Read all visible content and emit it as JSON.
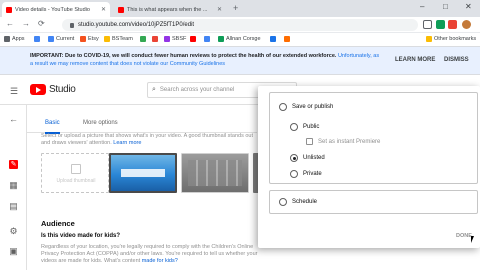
{
  "browser": {
    "tabs": [
      {
        "label": "Video details - YouTube Studio",
        "active": true
      },
      {
        "label": "This is what appears when the ...",
        "active": false
      }
    ],
    "new_tab": "+",
    "window_controls": {
      "minimize": "–",
      "maximize": "□",
      "close": "✕"
    },
    "back": "←",
    "forward": "→",
    "reload": "⟳",
    "url": "studio.youtube.com/video/10jPZ5fT1P0/edit"
  },
  "bookmarks": {
    "items": [
      {
        "label": "Apps",
        "color": "#5f6368"
      },
      {
        "label": "",
        "color": "#4285f4"
      },
      {
        "label": "Current",
        "color": "#4285f4"
      },
      {
        "label": "Etsy",
        "color": "#f4511e"
      },
      {
        "label": "BSTeam",
        "color": "#fbbc04"
      },
      {
        "label": "",
        "color": "#34a853"
      },
      {
        "label": "",
        "color": "#ea4335"
      },
      {
        "label": "SBSF",
        "color": "#9334e6"
      },
      {
        "label": "",
        "color": "#ff0000"
      },
      {
        "label": "",
        "color": "#4285f4"
      },
      {
        "label": "Allnan Corsge",
        "color": "#0f9d58"
      },
      {
        "label": "",
        "color": "#1a73e8"
      },
      {
        "label": "",
        "color": "#ff6d00"
      }
    ],
    "other": "Other bookmarks"
  },
  "banner": {
    "bold": "IMPORTANT: Due to COVID-19, we will conduct fewer human reviews to protect the health of our extended workforce.",
    "rest": " Unfortunately, as a result we may remove content that does not violate our Community Guidelines",
    "learn_more": "LEARN MORE",
    "dismiss": "DISMISS"
  },
  "studio": {
    "logo_text": "Studio",
    "search_placeholder": "Search across your channel"
  },
  "details": {
    "tabs": [
      "Basic",
      "More options"
    ],
    "thumbnail_desc": "Select or upload a picture that shows what's in your video. A good thumbnail stands out and draws viewers' attention.",
    "learn_more": "Learn more",
    "upload_thumbnail": "Upload thumbnail",
    "audience_title": "Audience",
    "made_for_kids": "Is this video made for kids?",
    "regards_text": "Regardless of your location, you're legally required to comply with the Children's Online Privacy Protection Act (COPPA) and/or other laws. You're required to tell us whether your videos are made for kids. What's content",
    "made_for_kids_link": "made for kids?"
  },
  "visibility": {
    "save_or_publish": "Save or publish",
    "public": "Public",
    "instant_premiere": "Set as instant Premiere",
    "unlisted": "Unlisted",
    "private": "Private",
    "schedule": "Schedule",
    "done": "DONE",
    "selected": "Unlisted"
  }
}
